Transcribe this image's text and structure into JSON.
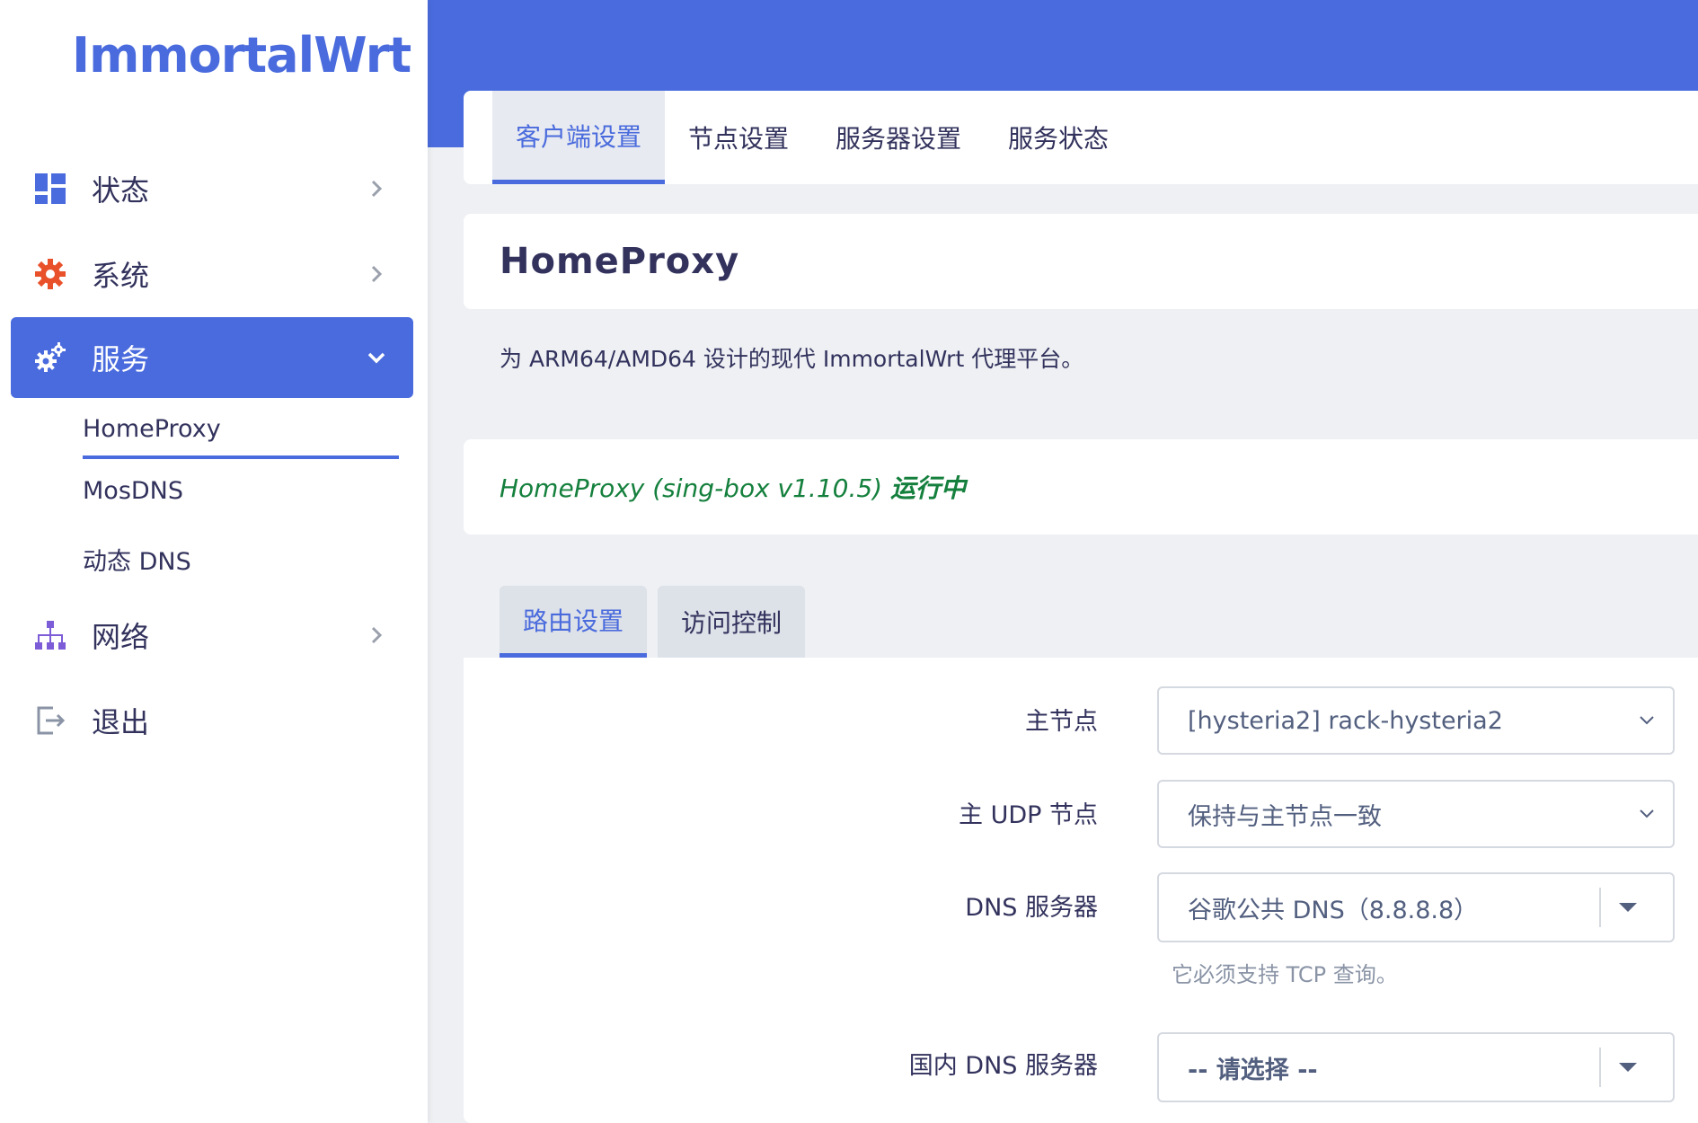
{
  "brand": "ImmortalWrt",
  "sidebar": {
    "items": [
      {
        "label": "状态",
        "icon": "dashboard-icon"
      },
      {
        "label": "系统",
        "icon": "gear-icon"
      },
      {
        "label": "服务",
        "icon": "cogs-icon"
      },
      {
        "label": "网络",
        "icon": "network-icon"
      },
      {
        "label": "退出",
        "icon": "logout-icon"
      }
    ],
    "sub_items": [
      {
        "label": "HomeProxy"
      },
      {
        "label": "MosDNS"
      },
      {
        "label": "动态 DNS"
      }
    ]
  },
  "tabs": [
    {
      "label": "客户端设置"
    },
    {
      "label": "节点设置"
    },
    {
      "label": "服务器设置"
    },
    {
      "label": "服务状态"
    }
  ],
  "page": {
    "title": "HomeProxy",
    "description": "为 ARM64/AMD64 设计的现代 ImmortalWrt 代理平台。",
    "status_prefix": "HomeProxy (sing-box v1.10.5) ",
    "status_state": "运行中"
  },
  "form_tabs": [
    {
      "label": "路由设置"
    },
    {
      "label": "访问控制"
    }
  ],
  "fields": {
    "main_node": {
      "label": "主节点",
      "value": "[hysteria2] rack-hysteria2"
    },
    "main_udp_node": {
      "label": "主 UDP 节点",
      "value": "保持与主节点一致"
    },
    "dns_server": {
      "label": "DNS 服务器",
      "value": "谷歌公共 DNS（8.8.8.8）",
      "hint": "它必须支持 TCP 查询。"
    },
    "china_dns_server": {
      "label": "国内 DNS 服务器",
      "value": "-- 请选择 --"
    }
  },
  "colors": {
    "accent": "#4a6bdd",
    "status_ok": "#15803d",
    "gear_icon": "#e8512a"
  }
}
